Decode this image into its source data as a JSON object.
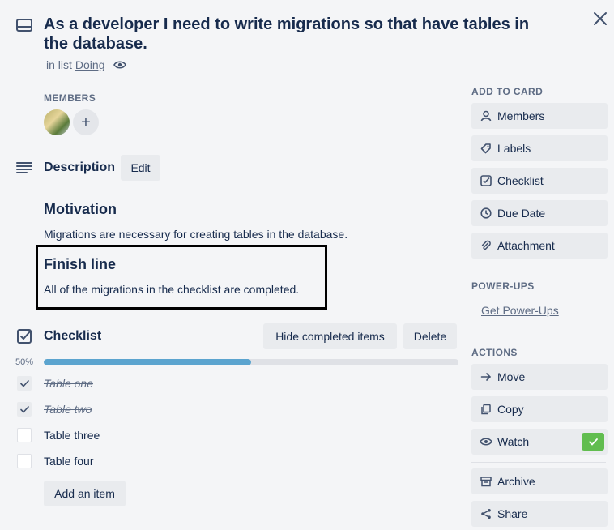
{
  "card": {
    "title": "As a developer I need to write migrations so that have tables in the database.",
    "in_list_prefix": "in list",
    "list_name": "Doing"
  },
  "members": {
    "label": "MEMBERS",
    "add_symbol": "+"
  },
  "description": {
    "title": "Description",
    "edit_label": "Edit",
    "motivation_heading": "Motivation",
    "motivation_text": "Migrations are necessary for creating tables in the database.",
    "finish_heading": "Finish line",
    "finish_text": "All of the migrations in the checklist are completed."
  },
  "checklist": {
    "title": "Checklist",
    "hide_completed_label": "Hide completed items",
    "delete_label": "Delete",
    "progress_label": "50%",
    "progress_fraction": 0.5,
    "items": [
      {
        "text": "Table one",
        "checked": true
      },
      {
        "text": "Table two",
        "checked": true
      },
      {
        "text": "Table three",
        "checked": false
      },
      {
        "text": "Table four",
        "checked": false
      }
    ],
    "add_item_label": "Add an item"
  },
  "sidebar": {
    "add_to_card_label": "ADD TO CARD",
    "add_to_card": [
      {
        "label": "Members",
        "icon": "person-icon"
      },
      {
        "label": "Labels",
        "icon": "tag-icon"
      },
      {
        "label": "Checklist",
        "icon": "checkbox-icon"
      },
      {
        "label": "Due Date",
        "icon": "clock-icon"
      },
      {
        "label": "Attachment",
        "icon": "paperclip-icon"
      }
    ],
    "power_ups_label": "POWER-UPS",
    "get_power_ups": "Get Power-Ups",
    "actions_label": "ACTIONS",
    "actions": [
      {
        "label": "Move",
        "icon": "arrow-right-icon"
      },
      {
        "label": "Copy",
        "icon": "copy-icon"
      },
      {
        "label": "Watch",
        "icon": "eye-icon"
      },
      {
        "label": "Archive",
        "icon": "archive-icon"
      },
      {
        "label": "Share",
        "icon": "share-icon"
      }
    ]
  },
  "colors": {
    "progress": "#5ba4cf",
    "watch_active": "#61bd4f"
  }
}
